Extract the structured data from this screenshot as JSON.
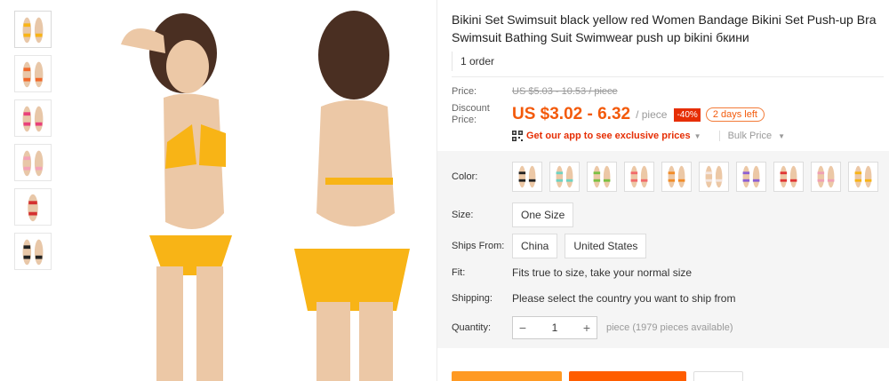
{
  "product": {
    "title": "Bikini Set Swimsuit black yellow red Women Bandage Bikini Set Push-up Bra Swimsuit Bathing Suit Swimwear push up bikini бкини",
    "orders": "1 order"
  },
  "price": {
    "label": "Price:",
    "original": "US $5.03 - 10.53 / piece",
    "discount_label": "Discount Price:",
    "discount": "US $3.02 - 6.32",
    "unit": "/ piece",
    "percent_off": "-40%",
    "time_left": "2 days left",
    "app_promo": "Get our app to see exclusive prices",
    "bulk": "Bulk Price"
  },
  "options": {
    "color_label": "Color:",
    "colors": [
      "black",
      "mint",
      "green",
      "coral",
      "orange",
      "white",
      "purple",
      "red",
      "pink",
      "yellow"
    ],
    "size_label": "Size:",
    "size_value": "One Size",
    "ships_label": "Ships From:",
    "ships_from": [
      "China",
      "United States"
    ],
    "fit_label": "Fit:",
    "fit_value": "Fits true to size, take your normal size",
    "shipping_label": "Shipping:",
    "shipping_value": "Please select the country you want to ship from",
    "quantity_label": "Quantity:",
    "quantity_value": "1",
    "quantity_note": "piece (1979 pieces available)"
  },
  "colors": {
    "accent": "#f35a0b",
    "badge": "#e62e04",
    "buy": "#ff9a23",
    "cart": "#ff5d00",
    "swimsuit": "#f8b416"
  },
  "icons": {
    "qr": "qr-code-icon",
    "minus": "minus-icon",
    "plus": "plus-icon"
  }
}
